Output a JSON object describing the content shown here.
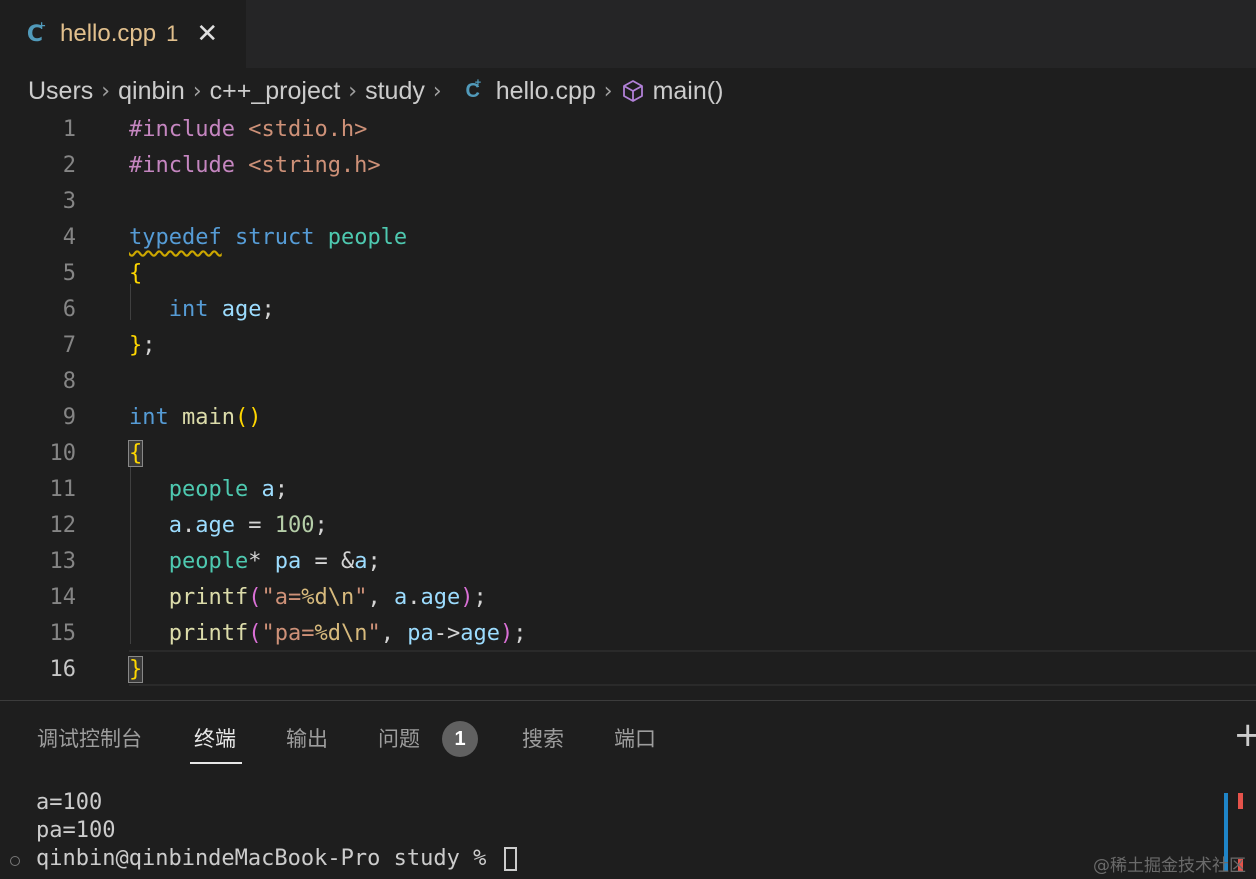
{
  "tab": {
    "title": "hello.cpp",
    "badge": "1",
    "close": "✕"
  },
  "breadcrumb": {
    "items": [
      "Users",
      "qinbin",
      "c++_project",
      "study"
    ],
    "file": "hello.cpp",
    "symbol": "main()",
    "separator": "›"
  },
  "editor": {
    "line_numbers": [
      "1",
      "2",
      "3",
      "4",
      "5",
      "6",
      "7",
      "8",
      "9",
      "10",
      "11",
      "12",
      "13",
      "14",
      "15",
      "16"
    ],
    "lines": [
      [
        {
          "t": "#include ",
          "c": "c-pp"
        },
        {
          "t": "<stdio.h>",
          "c": "c-str"
        }
      ],
      [
        {
          "t": "#include ",
          "c": "c-pp"
        },
        {
          "t": "<string.h>",
          "c": "c-str"
        }
      ],
      [],
      [
        {
          "t": "typedef",
          "c": "c-kw squiggle"
        },
        {
          "t": " ",
          "c": "c-pun"
        },
        {
          "t": "struct",
          "c": "c-kw"
        },
        {
          "t": " ",
          "c": "c-pun"
        },
        {
          "t": "people",
          "c": "c-type"
        }
      ],
      [
        {
          "t": "{",
          "c": "c-br"
        }
      ],
      [
        {
          "t": "   ",
          "c": "c-pun"
        },
        {
          "t": "int",
          "c": "c-kw"
        },
        {
          "t": " ",
          "c": "c-pun"
        },
        {
          "t": "age",
          "c": "c-var"
        },
        {
          "t": ";",
          "c": "c-pun"
        }
      ],
      [
        {
          "t": "}",
          "c": "c-br"
        },
        {
          "t": ";",
          "c": "c-pun"
        }
      ],
      [],
      [
        {
          "t": "int",
          "c": "c-kw"
        },
        {
          "t": " ",
          "c": "c-pun"
        },
        {
          "t": "main",
          "c": "c-fn"
        },
        {
          "t": "()",
          "c": "c-br"
        }
      ],
      [
        {
          "t": "{",
          "c": "c-br bracket-match"
        }
      ],
      [
        {
          "t": "   ",
          "c": "c-pun"
        },
        {
          "t": "people",
          "c": "c-type"
        },
        {
          "t": " ",
          "c": "c-pun"
        },
        {
          "t": "a",
          "c": "c-var"
        },
        {
          "t": ";",
          "c": "c-pun"
        }
      ],
      [
        {
          "t": "   ",
          "c": "c-pun"
        },
        {
          "t": "a",
          "c": "c-var"
        },
        {
          "t": ".",
          "c": "c-pun"
        },
        {
          "t": "age",
          "c": "c-var"
        },
        {
          "t": " = ",
          "c": "c-pun"
        },
        {
          "t": "100",
          "c": "c-num"
        },
        {
          "t": ";",
          "c": "c-pun"
        }
      ],
      [
        {
          "t": "   ",
          "c": "c-pun"
        },
        {
          "t": "people",
          "c": "c-type"
        },
        {
          "t": "* ",
          "c": "c-pun"
        },
        {
          "t": "pa",
          "c": "c-var"
        },
        {
          "t": " = &",
          "c": "c-pun"
        },
        {
          "t": "a",
          "c": "c-var"
        },
        {
          "t": ";",
          "c": "c-pun"
        }
      ],
      [
        {
          "t": "   ",
          "c": "c-pun"
        },
        {
          "t": "printf",
          "c": "c-fn"
        },
        {
          "t": "(",
          "c": "c-br2"
        },
        {
          "t": "\"a=",
          "c": "c-str"
        },
        {
          "t": "%d\\n",
          "c": "c-esc"
        },
        {
          "t": "\"",
          "c": "c-str"
        },
        {
          "t": ", ",
          "c": "c-pun"
        },
        {
          "t": "a",
          "c": "c-var"
        },
        {
          "t": ".",
          "c": "c-pun"
        },
        {
          "t": "age",
          "c": "c-var"
        },
        {
          "t": ")",
          "c": "c-br2"
        },
        {
          "t": ";",
          "c": "c-pun"
        }
      ],
      [
        {
          "t": "   ",
          "c": "c-pun"
        },
        {
          "t": "printf",
          "c": "c-fn"
        },
        {
          "t": "(",
          "c": "c-br2"
        },
        {
          "t": "\"pa=",
          "c": "c-str"
        },
        {
          "t": "%d\\n",
          "c": "c-esc"
        },
        {
          "t": "\"",
          "c": "c-str"
        },
        {
          "t": ", ",
          "c": "c-pun"
        },
        {
          "t": "pa",
          "c": "c-var"
        },
        {
          "t": "->",
          "c": "c-pun"
        },
        {
          "t": "age",
          "c": "c-var"
        },
        {
          "t": ")",
          "c": "c-br2"
        },
        {
          "t": ";",
          "c": "c-pun"
        }
      ],
      [
        {
          "t": "}",
          "c": "c-br bracket-match"
        }
      ]
    ],
    "active_line": "16"
  },
  "panel": {
    "tabs": [
      "调试控制台",
      "终端",
      "输出",
      "问题",
      "搜索",
      "端口"
    ],
    "active_tab": "终端",
    "problems_count": "1",
    "plus": "+",
    "terminal_lines": [
      "a=100",
      "pa=100"
    ],
    "prompt": "qinbin@qinbindeMacBook-Pro study % "
  },
  "watermark": "@稀土掘金技术社区",
  "colors": {
    "accent": "#e2c08d",
    "bg": "#1e1e1e",
    "keyword": "#569cd6",
    "type": "#4ec9b0"
  },
  "icons": {
    "file": "cpp-file-icon",
    "symbol": "cube-icon",
    "close": "close-icon"
  }
}
